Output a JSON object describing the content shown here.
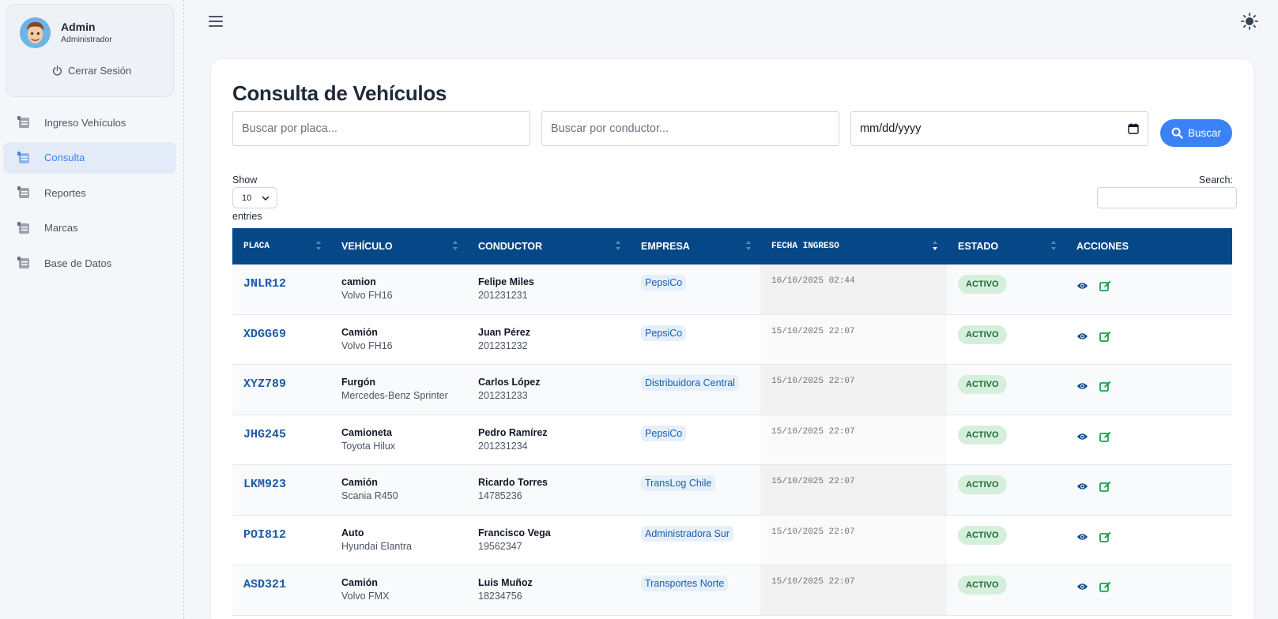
{
  "user": {
    "name": "Admin",
    "role": "Administrador",
    "logout_label": "Cerrar Sesión"
  },
  "sidebar": {
    "items": [
      {
        "label": "Ingreso Vehículos",
        "active": false
      },
      {
        "label": "Consulta",
        "active": true
      },
      {
        "label": "Reportes",
        "active": false
      },
      {
        "label": "Marcas",
        "active": false
      },
      {
        "label": "Base de Datos",
        "active": false
      }
    ]
  },
  "page": {
    "title": "Consulta de Vehículos"
  },
  "filters": {
    "placa_placeholder": "Buscar por placa...",
    "conductor_placeholder": "Buscar por conductor...",
    "date_value": "mm/dd/yyyy",
    "search_button": "Buscar"
  },
  "table_controls": {
    "show_label": "Show",
    "length_value": "10",
    "entries_label": "entries",
    "search_label": "Search:"
  },
  "table": {
    "columns": [
      "PLACA",
      "VEHÍCULO",
      "CONDUCTOR",
      "EMPRESA",
      "FECHA INGRESO",
      "ESTADO",
      "ACCIONES"
    ],
    "rows": [
      {
        "placa": "JNLR12",
        "tipo": "camion",
        "modelo": "Volvo FH16",
        "conductor": "Felipe Miles",
        "rut": "201231231",
        "empresa": "PepsiCo",
        "fecha": "16/10/2025 02:44",
        "estado": "ACTIVO"
      },
      {
        "placa": "XDGG69",
        "tipo": "Camión",
        "modelo": "Volvo FH16",
        "conductor": "Juan Pérez",
        "rut": "201231232",
        "empresa": "PepsiCo",
        "fecha": "15/10/2025 22:07",
        "estado": "ACTIVO"
      },
      {
        "placa": "XYZ789",
        "tipo": "Furgón",
        "modelo": "Mercedes-Benz Sprinter",
        "conductor": "Carlos López",
        "rut": "201231233",
        "empresa": "Distribuidora Central",
        "fecha": "15/10/2025 22:07",
        "estado": "ACTIVO"
      },
      {
        "placa": "JHG245",
        "tipo": "Camioneta",
        "modelo": "Toyota Hilux",
        "conductor": "Pedro Ramírez",
        "rut": "201231234",
        "empresa": "PepsiCo",
        "fecha": "15/10/2025 22:07",
        "estado": "ACTIVO"
      },
      {
        "placa": "LKM923",
        "tipo": "Camión",
        "modelo": "Scania R450",
        "conductor": "Ricardo Torres",
        "rut": "14785236",
        "empresa": "TransLog Chile",
        "fecha": "15/10/2025 22:07",
        "estado": "ACTIVO"
      },
      {
        "placa": "POI812",
        "tipo": "Auto",
        "modelo": "Hyundai Elantra",
        "conductor": "Francisco Vega",
        "rut": "19562347",
        "empresa": "Administradora Sur",
        "fecha": "15/10/2025 22:07",
        "estado": "ACTIVO"
      },
      {
        "placa": "ASD321",
        "tipo": "Camión",
        "modelo": "Volvo FMX",
        "conductor": "Luis Muñoz",
        "rut": "18234756",
        "empresa": "Transportes Norte",
        "fecha": "15/10/2025 22:07",
        "estado": "ACTIVO"
      }
    ]
  },
  "icons": {
    "menu": "hamburger-icon",
    "theme": "sun-icon",
    "logout": "power-icon",
    "nav": "list-icon",
    "search": "search-icon",
    "calendar": "calendar-icon",
    "view": "eye-icon",
    "edit": "edit-icon"
  },
  "colors": {
    "primary": "#3b82f6",
    "table_header": "#064788",
    "placa": "#1e5aa8",
    "badge_bg": "#d6efdc",
    "badge_text": "#1d6b34",
    "company_bg": "#e6f0fb"
  }
}
